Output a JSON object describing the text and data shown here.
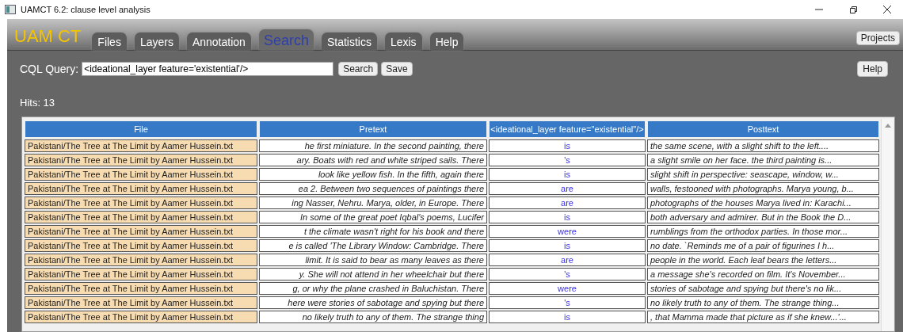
{
  "window": {
    "title": "UAMCT 6.2: clause level analysis"
  },
  "app": {
    "logo": "UAM CT",
    "projects_button": "Projects"
  },
  "tabs": [
    {
      "label": "Files",
      "selected": false
    },
    {
      "label": "Layers",
      "selected": false
    },
    {
      "label": "Annotation",
      "selected": false
    },
    {
      "label": "Search",
      "selected": true
    },
    {
      "label": "Statistics",
      "selected": false
    },
    {
      "label": "Lexis",
      "selected": false
    },
    {
      "label": "Help",
      "selected": false
    }
  ],
  "query": {
    "label": "CQL Query:",
    "value": "<ideational_layer feature='existential'/>",
    "search_button": "Search",
    "save_button": "Save",
    "help_button": "Help"
  },
  "hits": "Hits: 13",
  "table": {
    "columns": [
      "File",
      "Pretext",
      "<ideational_layer feature=\"existential\"/>",
      "Posttext"
    ],
    "rows": [
      [
        "Pakistani/The Tree at The Limit by Aamer Hussein.txt",
        "he first miniature. In the second painting, there",
        "is",
        "the same scene, with a slight shift to the left...."
      ],
      [
        "Pakistani/The Tree at The Limit by Aamer Hussein.txt",
        "ary. Boats with red and white striped sails. There",
        "'s",
        "a slight smile on her face. the third painting is..."
      ],
      [
        "Pakistani/The Tree at The Limit by Aamer Hussein.txt",
        "look like yellow fish. In the fifth, again there",
        "is",
        "slight shift in perspective: seascape, window, w..."
      ],
      [
        "Pakistani/The Tree at The Limit by Aamer Hussein.txt",
        "ea 2. Between two sequences of paintings there",
        "are",
        "walls, festooned with photographs. Marya young, b..."
      ],
      [
        "Pakistani/The Tree at The Limit by Aamer Hussein.txt",
        "ing Nasser, Nehru. Marya, older, in Europe. There",
        "are",
        "photographs of the houses Marya lived in: Karachi..."
      ],
      [
        "Pakistani/The Tree at The Limit by Aamer Hussein.txt",
        "In some of the great poet Iqbal's poems, Lucifer",
        "is",
        "both adversary and admirer. But in the Book the D..."
      ],
      [
        "Pakistani/The Tree at The Limit by Aamer Hussein.txt",
        "t the climate wasn't right for his book and there",
        "were",
        "rumblings from the orthodox parties. In those mor..."
      ],
      [
        "Pakistani/The Tree at The Limit by Aamer Hussein.txt",
        "e is called 'The Library Window: Cambridge. There",
        "is",
        "no date. `Reminds me of a pair of figurines I h..."
      ],
      [
        "Pakistani/The Tree at The Limit by Aamer Hussein.txt",
        "limit. It is said to bear as many leaves as there",
        "are",
        "people in the world. Each leaf bears the letters..."
      ],
      [
        "Pakistani/The Tree at The Limit by Aamer Hussein.txt",
        "y. She will not attend in her wheelchair but there",
        "'s",
        "a message she's recorded on film. It's November..."
      ],
      [
        "Pakistani/The Tree at The Limit by Aamer Hussein.txt",
        "g, or why the plane crashed in Baluchistan. There",
        "were",
        "stories of sabotage and spying but there's no lik..."
      ],
      [
        "Pakistani/The Tree at The Limit by Aamer Hussein.txt",
        "here were stories of sabotage and spying but there",
        "'s",
        "no likely truth to any of them. The strange thing..."
      ],
      [
        "Pakistani/The Tree at The Limit by Aamer Hussein.txt",
        "no likely truth to any of them. The strange thing",
        "is",
        ", that Mamma made that picture as if she knew...'..."
      ]
    ]
  }
}
